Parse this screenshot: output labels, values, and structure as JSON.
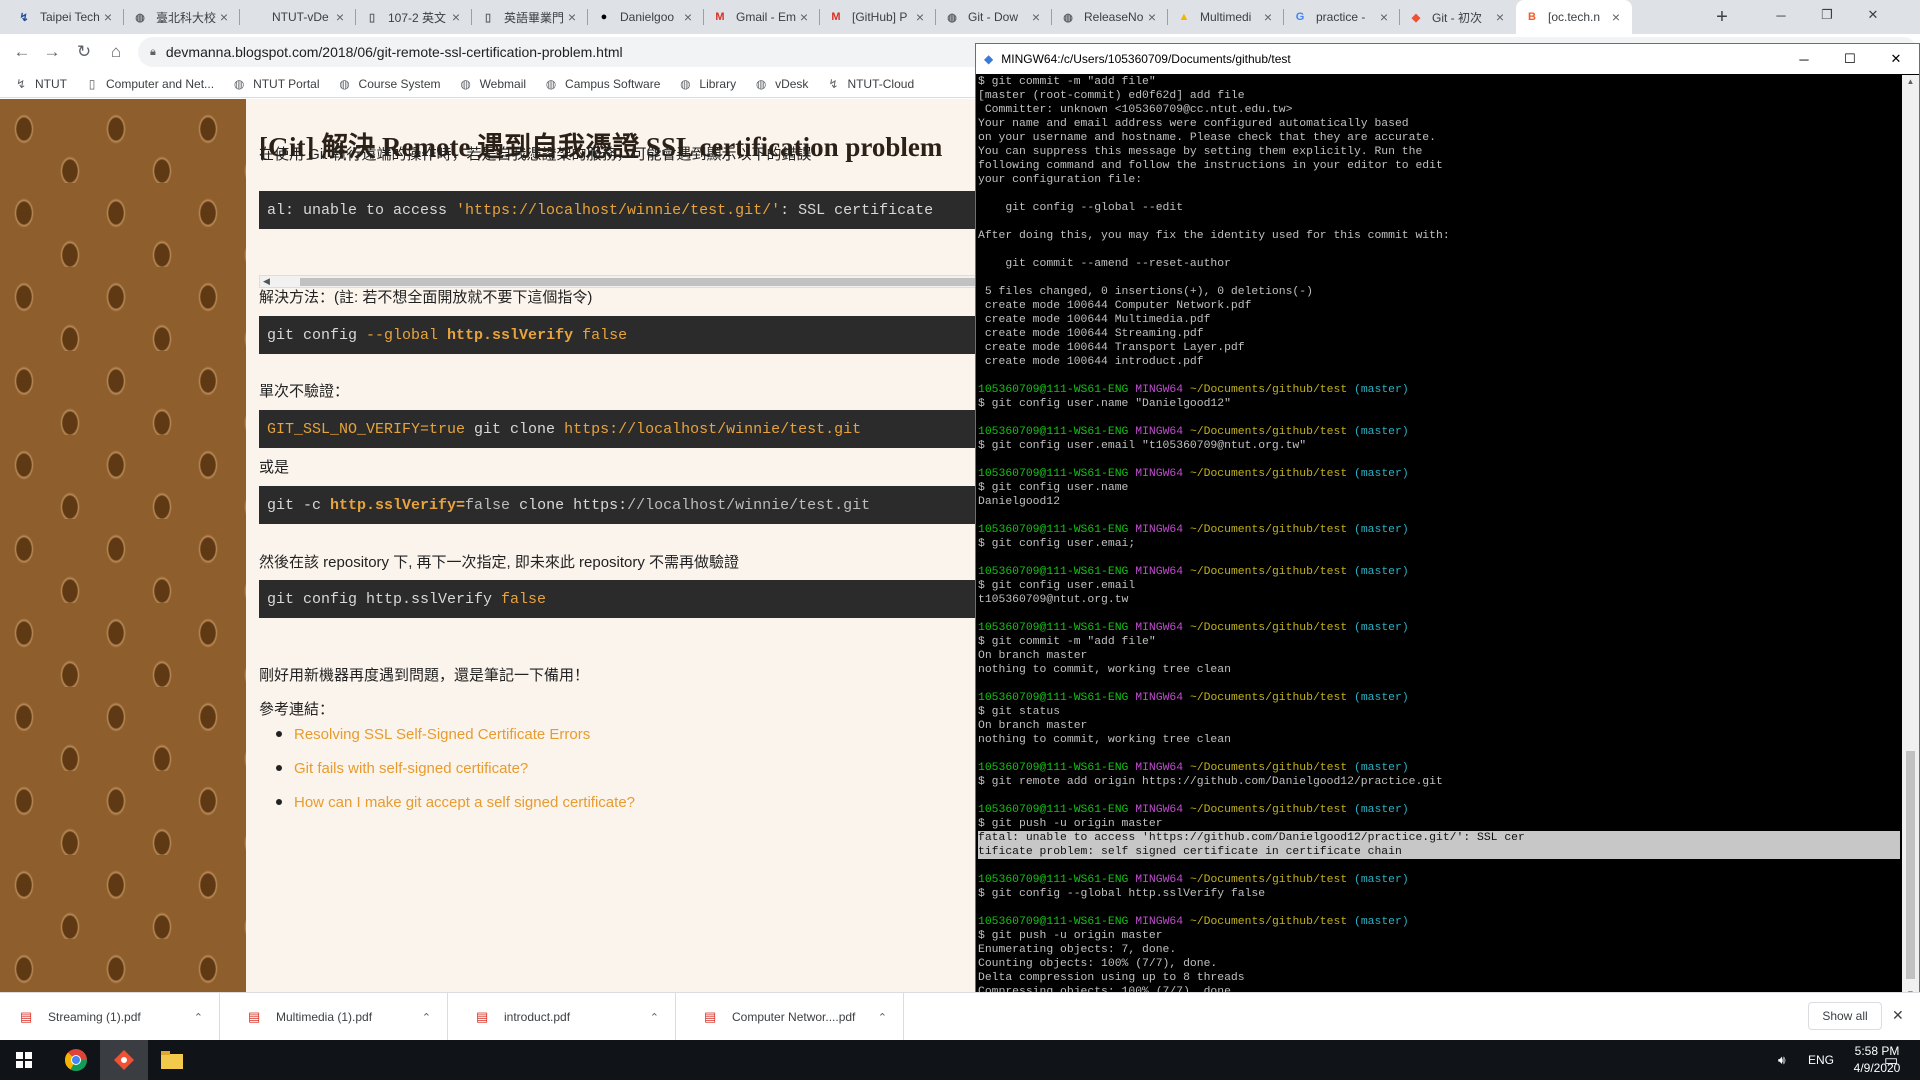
{
  "browser": {
    "tabs": [
      {
        "title": "Taipei Tech",
        "icon": "ntut-icon",
        "color": "#1f4e9c"
      },
      {
        "title": "臺北科大校",
        "icon": "globe-icon",
        "color": "#5f6368"
      },
      {
        "title": "NTUT-vDe",
        "icon": "none",
        "color": "#5f6368"
      },
      {
        "title": "107-2 英文",
        "icon": "document-icon",
        "color": "#5f6368"
      },
      {
        "title": "英語畢業門",
        "icon": "document-icon",
        "color": "#5f6368"
      },
      {
        "title": "Danielgoo",
        "icon": "github-icon",
        "color": "#000000"
      },
      {
        "title": "Gmail - Em",
        "icon": "gmail-icon",
        "color": "#d93025"
      },
      {
        "title": "[GitHub] P",
        "icon": "gmail-icon",
        "color": "#d93025"
      },
      {
        "title": "Git - Dow",
        "icon": "globe-icon",
        "color": "#5f6368"
      },
      {
        "title": "ReleaseNo",
        "icon": "globe-icon",
        "color": "#5f6368"
      },
      {
        "title": "Multimedi",
        "icon": "drive-icon",
        "color": "#f4b400"
      },
      {
        "title": "practice -",
        "icon": "google-icon",
        "color": "#4285f4"
      },
      {
        "title": "Git - 初次",
        "icon": "git-icon",
        "color": "#f05033"
      },
      {
        "title": "[oc.tech.n",
        "icon": "blogger-icon",
        "color": "#ff5722"
      }
    ],
    "url": "devmanna.blogspot.com/2018/06/git-remote-ssl-certification-problem.html",
    "bookmarks": [
      "NTUT",
      "Computer and Net...",
      "NTUT Portal",
      "Course System",
      "Webmail",
      "Campus Software",
      "Library",
      "vDesk",
      "NTUT-Cloud"
    ]
  },
  "post": {
    "title": "[Git] 解決 Remote 遇到自我憑證 SSL certification problem",
    "intro": "在使用 Git 執行遠端的操作時，若是自我憑證架的服務，可能會遇到顯示以下的錯誤",
    "error_line": {
      "a": "al: unable to access ",
      "b": "'https://localhost/winnie/test.git/'",
      "c": ": SSL certificate"
    },
    "solution_label": "解決方法：(註: 若不想全面開放就不要下這個指令)",
    "code1": {
      "a": "git config ",
      "b": "--global",
      "c": " http.sslVerify ",
      "d": "false"
    },
    "single_label": "單次不驗證：",
    "code2": {
      "a": "GIT_SSL_NO_VERIFY=true",
      "b": " git clone ",
      "c": "https://localhost/winnie/test.git"
    },
    "or_label": "或是",
    "code3": {
      "a": "git -c ",
      "b": "http.sslVerify=",
      "c": "false",
      "d": " clone ",
      "e": "https:",
      "f": "//localhost/winnie/test.git"
    },
    "repo_label": "然後在該 repository 下, 再下一次指定, 即未來此 repository 不需再做驗證",
    "code4": {
      "a": "git config http.sslVerify ",
      "b": "false"
    },
    "note": "剛好用新機器再度遇到問題，還是筆記一下備用！",
    "ref_label": "參考連結：",
    "refs": [
      "Resolving SSL Self-Signed Certificate Errors",
      "Git fails with self-signed certificate?",
      "How can I make git accept a self signed certificate?"
    ]
  },
  "terminal": {
    "title": "MINGW64:/c/Users/105360709/Documents/github/test",
    "prompt": {
      "host": "105360709@111-WS61-ENG",
      "env": "MINGW64",
      "path": "~/Documents/github/test",
      "branch": "(master)"
    },
    "lines": [
      {
        "t": "out",
        "text": "$ git commit -m \"add file\""
      },
      {
        "t": "out",
        "text": "[master (root-commit) ed0f62d] add file"
      },
      {
        "t": "out",
        "text": " Committer: unknown <105360709@cc.ntut.edu.tw>"
      },
      {
        "t": "out",
        "text": "Your name and email address were configured automatically based"
      },
      {
        "t": "out",
        "text": "on your username and hostname. Please check that they are accurate."
      },
      {
        "t": "out",
        "text": "You can suppress this message by setting them explicitly. Run the"
      },
      {
        "t": "out",
        "text": "following command and follow the instructions in your editor to edit"
      },
      {
        "t": "out",
        "text": "your configuration file:"
      },
      {
        "t": "out",
        "text": ""
      },
      {
        "t": "out",
        "text": "    git config --global --edit"
      },
      {
        "t": "out",
        "text": ""
      },
      {
        "t": "out",
        "text": "After doing this, you may fix the identity used for this commit with:"
      },
      {
        "t": "out",
        "text": ""
      },
      {
        "t": "out",
        "text": "    git commit --amend --reset-author"
      },
      {
        "t": "out",
        "text": ""
      },
      {
        "t": "out",
        "text": " 5 files changed, 0 insertions(+), 0 deletions(-)"
      },
      {
        "t": "out",
        "text": " create mode 100644 Computer Network.pdf"
      },
      {
        "t": "out",
        "text": " create mode 100644 Multimedia.pdf"
      },
      {
        "t": "out",
        "text": " create mode 100644 Streaming.pdf"
      },
      {
        "t": "out",
        "text": " create mode 100644 Transport Layer.pdf"
      },
      {
        "t": "out",
        "text": " create mode 100644 introduct.pdf"
      },
      {
        "t": "out",
        "text": ""
      },
      {
        "t": "prompt"
      },
      {
        "t": "out",
        "text": "$ git config user.name \"Danielgood12\""
      },
      {
        "t": "out",
        "text": ""
      },
      {
        "t": "prompt"
      },
      {
        "t": "out",
        "text": "$ git config user.email \"t105360709@ntut.org.tw\""
      },
      {
        "t": "out",
        "text": ""
      },
      {
        "t": "prompt"
      },
      {
        "t": "out",
        "text": "$ git config user.name"
      },
      {
        "t": "out",
        "text": "Danielgood12"
      },
      {
        "t": "out",
        "text": ""
      },
      {
        "t": "prompt"
      },
      {
        "t": "out",
        "text": "$ git config user.emai;"
      },
      {
        "t": "out",
        "text": ""
      },
      {
        "t": "prompt"
      },
      {
        "t": "out",
        "text": "$ git config user.email"
      },
      {
        "t": "out",
        "text": "t105360709@ntut.org.tw"
      },
      {
        "t": "out",
        "text": ""
      },
      {
        "t": "prompt"
      },
      {
        "t": "out",
        "text": "$ git commit -m \"add file\""
      },
      {
        "t": "out",
        "text": "On branch master"
      },
      {
        "t": "out",
        "text": "nothing to commit, working tree clean"
      },
      {
        "t": "out",
        "text": ""
      },
      {
        "t": "prompt"
      },
      {
        "t": "out",
        "text": "$ git status"
      },
      {
        "t": "out",
        "text": "On branch master"
      },
      {
        "t": "out",
        "text": "nothing to commit, working tree clean"
      },
      {
        "t": "out",
        "text": ""
      },
      {
        "t": "prompt"
      },
      {
        "t": "out",
        "text": "$ git remote add origin https://github.com/Danielgood12/practice.git"
      },
      {
        "t": "out",
        "text": ""
      },
      {
        "t": "prompt"
      },
      {
        "t": "out",
        "text": "$ git push -u origin master"
      },
      {
        "t": "hl",
        "text": "fatal: unable to access 'https://github.com/Danielgood12/practice.git/': SSL cer"
      },
      {
        "t": "hl",
        "text": "tificate problem: self signed certificate in certificate chain"
      },
      {
        "t": "out",
        "text": ""
      },
      {
        "t": "prompt"
      },
      {
        "t": "out",
        "text": "$ git config --global http.sslVerify false"
      },
      {
        "t": "out",
        "text": ""
      },
      {
        "t": "prompt"
      },
      {
        "t": "out",
        "text": "$ git push -u origin master"
      },
      {
        "t": "out",
        "text": "Enumerating objects: 7, done."
      },
      {
        "t": "out",
        "text": "Counting objects: 100% (7/7), done."
      },
      {
        "t": "out",
        "text": "Delta compression using up to 8 threads"
      },
      {
        "t": "out",
        "text": "Compressing objects: 100% (7/7), done."
      }
    ]
  },
  "downloads": {
    "items": [
      "Streaming (1).pdf",
      "Multimedia (1).pdf",
      "introduct.pdf",
      "Computer Networ....pdf"
    ],
    "show_all": "Show all"
  },
  "taskbar": {
    "lang": "ENG",
    "time": "5:58 PM",
    "date": "4/9/2020"
  }
}
